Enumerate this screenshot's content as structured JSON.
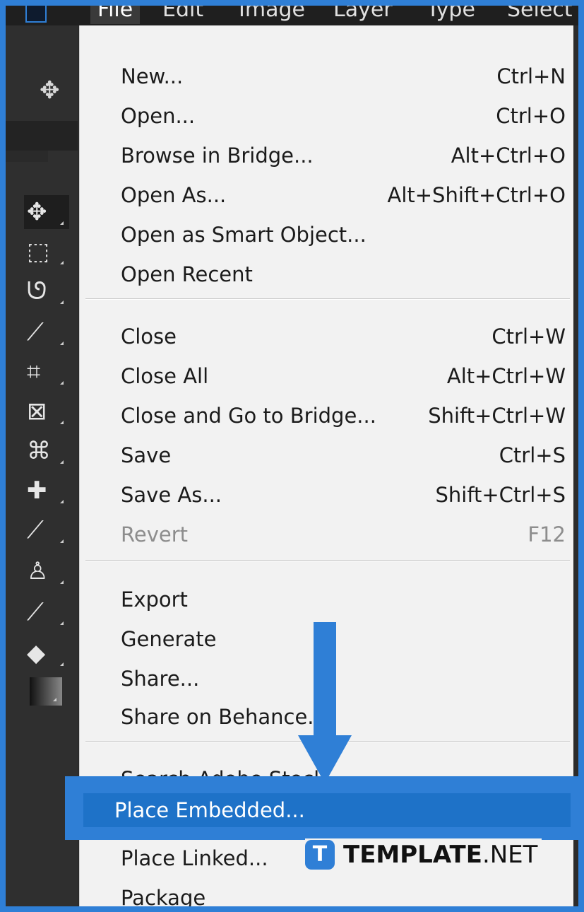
{
  "menubar": {
    "items": [
      "File",
      "Edit",
      "Image",
      "Layer",
      "Type",
      "Select"
    ]
  },
  "file_menu": {
    "groups": [
      [
        {
          "label": "New...",
          "shortcut": "Ctrl+N"
        },
        {
          "label": "Open...",
          "shortcut": "Ctrl+O"
        },
        {
          "label": "Browse in Bridge...",
          "shortcut": "Alt+Ctrl+O"
        },
        {
          "label": "Open As...",
          "shortcut": "Alt+Shift+Ctrl+O"
        },
        {
          "label": "Open as Smart Object...",
          "shortcut": ""
        },
        {
          "label": "Open Recent",
          "shortcut": ""
        }
      ],
      [
        {
          "label": "Close",
          "shortcut": "Ctrl+W"
        },
        {
          "label": "Close All",
          "shortcut": "Alt+Ctrl+W"
        },
        {
          "label": "Close and Go to Bridge...",
          "shortcut": "Shift+Ctrl+W"
        },
        {
          "label": "Save",
          "shortcut": "Ctrl+S"
        },
        {
          "label": "Save As...",
          "shortcut": "Shift+Ctrl+S"
        },
        {
          "label": "Revert",
          "shortcut": "F12",
          "disabled": true
        }
      ],
      [
        {
          "label": "Export",
          "shortcut": ""
        },
        {
          "label": "Generate",
          "shortcut": ""
        },
        {
          "label": "Share...",
          "shortcut": ""
        },
        {
          "label": "Share on Behance...",
          "shortcut": ""
        }
      ],
      [
        {
          "label": "Search Adobe Stock...",
          "shortcut": ""
        },
        {
          "label": "Place Embedded...",
          "shortcut": "",
          "highlighted": true
        },
        {
          "label": "Place Linked...",
          "shortcut": ""
        },
        {
          "label": "Package",
          "shortcut": ""
        }
      ]
    ]
  },
  "tools": [
    {
      "icon": "move-tool-icon",
      "glyph": "✥",
      "selected": true
    },
    {
      "icon": "marquee-tool-icon",
      "glyph": "⬚"
    },
    {
      "icon": "lasso-tool-icon",
      "glyph": "ᘎ"
    },
    {
      "icon": "quick-selection-tool-icon",
      "glyph": "⟋"
    },
    {
      "icon": "crop-tool-icon",
      "glyph": "⌗"
    },
    {
      "icon": "frame-tool-icon",
      "glyph": "⊠"
    },
    {
      "icon": "eyedropper-tool-icon",
      "glyph": "⌘"
    },
    {
      "icon": "healing-brush-tool-icon",
      "glyph": "✚"
    },
    {
      "icon": "brush-tool-icon",
      "glyph": "⟋"
    },
    {
      "icon": "stamp-tool-icon",
      "glyph": "♙"
    },
    {
      "icon": "history-brush-tool-icon",
      "glyph": "⟋"
    },
    {
      "icon": "eraser-tool-icon",
      "glyph": "◆"
    },
    {
      "icon": "gradient-tool-icon",
      "glyph": ""
    }
  ],
  "toolbar_top_icon": "move-arrows-icon",
  "highlight_color": "#1e72c8",
  "annotation_color": "#2f7fd6",
  "watermark": {
    "brand": "TEMPLATE",
    "suffix": ".NET",
    "logo_letter": "T"
  }
}
